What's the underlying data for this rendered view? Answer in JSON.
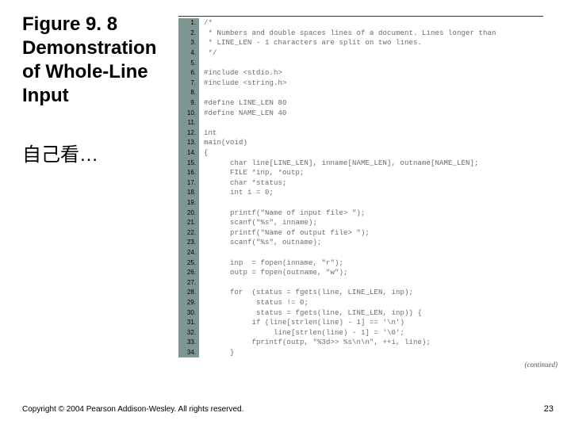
{
  "title_lines": [
    "Figure 9. 8",
    "Demonstration",
    "of Whole-Line",
    "Input"
  ],
  "subtitle": "自己看…",
  "copyright": "Copyright © 2004 Pearson Addison-Wesley. All rights reserved.",
  "page_number": "23",
  "continued": "(continued)",
  "code": {
    "lines": [
      "/*",
      " * Numbers and double spaces lines of a document. Lines longer than",
      " * LINE_LEN - 1 characters are split on two lines.",
      " */",
      "",
      "#include <stdio.h>",
      "#include <string.h>",
      "",
      "#define LINE_LEN 80",
      "#define NAME_LEN 40",
      "",
      "int",
      "main(void)",
      "{",
      "      char line[LINE_LEN], inname[NAME_LEN], outname[NAME_LEN];",
      "      FILE *inp, *outp;",
      "      char *status;",
      "      int i = 0;",
      "",
      "      printf(\"Name of input file> \");",
      "      scanf(\"%s\", inname);",
      "      printf(\"Name of output file> \");",
      "      scanf(\"%s\", outname);",
      "",
      "      inp  = fopen(inname, \"r\");",
      "      outp = fopen(outname, \"w\");",
      "",
      "      for  (status = fgets(line, LINE_LEN, inp);",
      "            status != 0;",
      "            status = fgets(line, LINE_LEN, inp)) {",
      "           if (line[strlen(line) - 1] == '\\n')",
      "                line[strlen(line) - 1] = '\\0';",
      "           fprintf(outp, \"%3d>> %s\\n\\n\", ++i, line);",
      "      }"
    ]
  }
}
